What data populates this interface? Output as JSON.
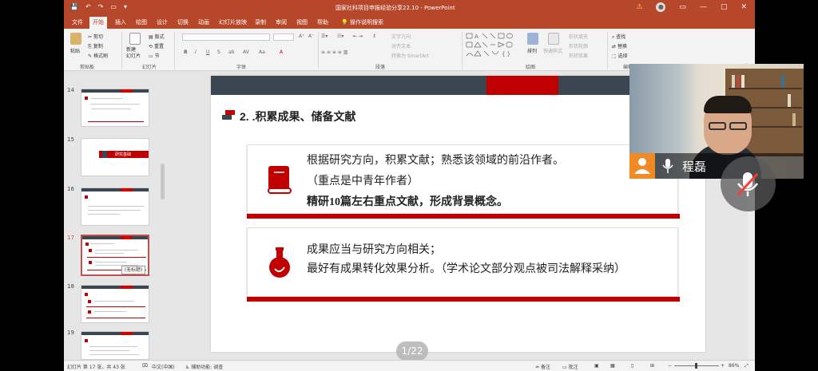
{
  "window": {
    "title": "国家社科项目申报经验分享22.10  -  PowerPoint",
    "quick_access": [
      "💾",
      "↶",
      "↷",
      "▭",
      "▾"
    ],
    "warning_icon": "⚠",
    "controls": [
      "▭",
      "—",
      "▢",
      "✕"
    ]
  },
  "tabs": [
    "文件",
    "开始",
    "插入",
    "绘图",
    "设计",
    "切换",
    "动画",
    "幻灯片放映",
    "录制",
    "审阅",
    "视图",
    "帮助",
    "操作说明搜索"
  ],
  "ribbon": {
    "paste": "粘贴",
    "cut": "剪切",
    "copy": "复制",
    "format_painter": "格式刷",
    "new_slide": "新建\n幻灯片",
    "layout": "版式",
    "reset": "重置",
    "section": "节",
    "text_direction": "文字方向",
    "align_text": "对齐文本",
    "smartart": "转换为 SmartArt",
    "arrange": "排列",
    "quick_styles": "快速样式",
    "shape_fill": "形状填充",
    "shape_outline": "形状轮廓",
    "shape_effect": "形状效果",
    "find": "查找",
    "replace": "替换",
    "select": "选择",
    "groups": [
      "剪贴板",
      "幻灯片",
      "字体",
      "段落",
      "绘图",
      "编辑"
    ]
  },
  "thumbnails": [
    {
      "num": "14"
    },
    {
      "num": "15",
      "label": "研究基础"
    },
    {
      "num": "16"
    },
    {
      "num": "17"
    },
    {
      "num": "18"
    },
    {
      "num": "19"
    }
  ],
  "thumb_tooltip": "(无标题)",
  "slide": {
    "heading": "2. .积累成果、储备文献",
    "card1": {
      "line1": "根据研究方向，积累文献；熟悉该领域的前沿作者。",
      "line2": "（重点是中青年作者）",
      "line3": "精研10篇左右重点文献，形成背景概念。"
    },
    "card2": {
      "line1": "成果应当与研究方向相关；",
      "line2": "最好有成果转化效果分析。（学术论文部分观点被司法解释采纳）"
    },
    "page_indicator": "1/22"
  },
  "video": {
    "participant_name": "程磊"
  },
  "status": {
    "slide_info": "幻灯片 第 17 张，共 43 张",
    "language": "中文(中国)",
    "accessibility": "辅助功能: 调查",
    "notes": "备注",
    "comments": "批注",
    "zoom": "86%"
  },
  "colors": {
    "accent": "#b7472a",
    "slide_red": "#c00000",
    "slide_band": "#3c4650"
  }
}
